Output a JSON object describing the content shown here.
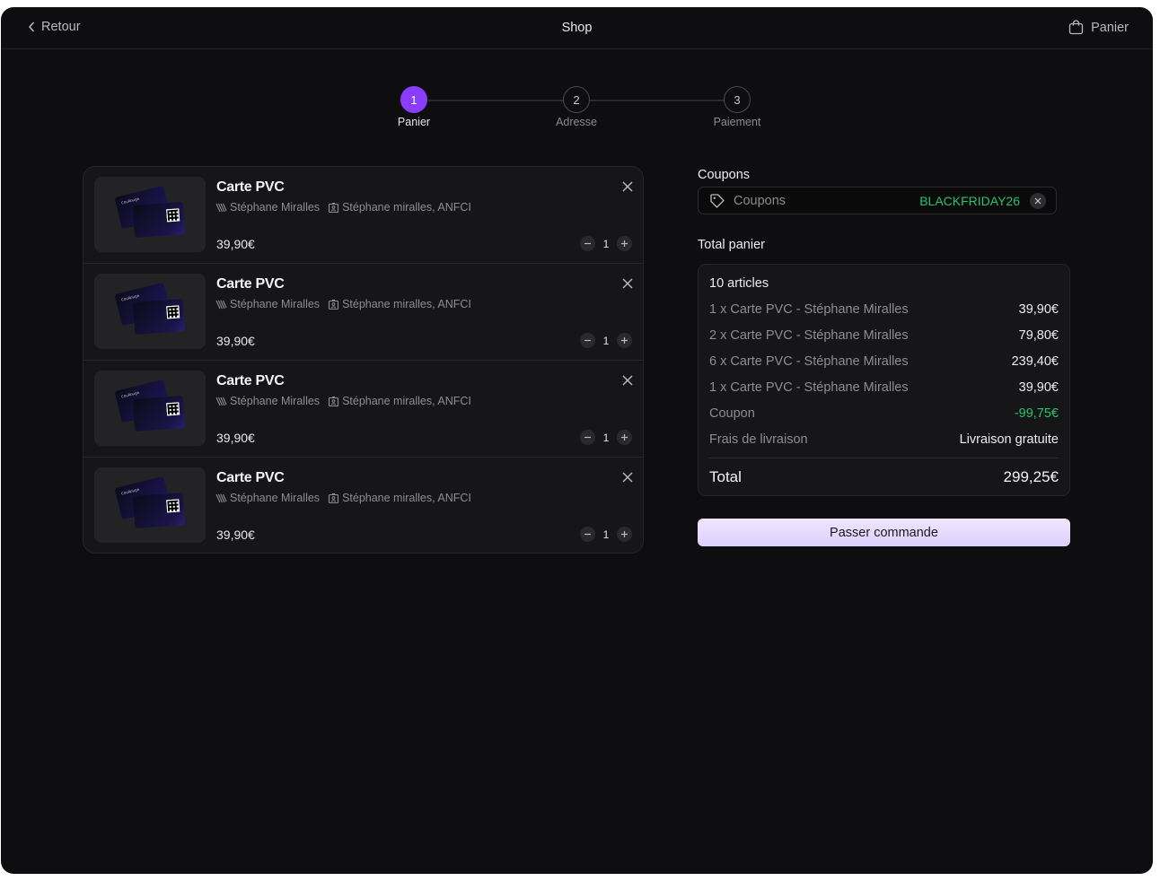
{
  "header": {
    "back_label": "Retour",
    "title": "Shop",
    "cart_label": "Panier"
  },
  "stepper": {
    "steps": [
      {
        "number": "1",
        "label": "Panier",
        "active": true
      },
      {
        "number": "2",
        "label": "Adresse",
        "active": false
      },
      {
        "number": "3",
        "label": "Paiement",
        "active": false
      }
    ]
  },
  "cart": {
    "items": [
      {
        "title": "Carte PVC",
        "author": "Stéphane Miralles",
        "org": "Stéphane miralles, ANFCI",
        "price": "39,90€",
        "quantity": "1",
        "card_logo": "CouRouge"
      },
      {
        "title": "Carte PVC",
        "author": "Stéphane Miralles",
        "org": "Stéphane miralles, ANFCI",
        "price": "39,90€",
        "quantity": "1",
        "card_logo": "CouRouge"
      },
      {
        "title": "Carte PVC",
        "author": "Stéphane Miralles",
        "org": "Stéphane miralles, ANFCI",
        "price": "39,90€",
        "quantity": "1",
        "card_logo": "CouRouge"
      },
      {
        "title": "Carte PVC",
        "author": "Stéphane Miralles",
        "org": "Stéphane miralles, ANFCI",
        "price": "39,90€",
        "quantity": "1",
        "card_logo": "CouRouge"
      }
    ]
  },
  "coupons": {
    "section_label": "Coupons",
    "placeholder": "Coupons",
    "applied_code": "BLACKFRIDAY26"
  },
  "summary": {
    "section_label": "Total panier",
    "count_label": "10 articles",
    "lines": [
      {
        "label": "1 x Carte PVC - Stéphane Miralles",
        "value": "39,90€"
      },
      {
        "label": "2 x Carte PVC - Stéphane Miralles",
        "value": "79,80€"
      },
      {
        "label": "6 x Carte PVC - Stéphane Miralles",
        "value": "239,40€"
      },
      {
        "label": "1 x Carte PVC - Stéphane Miralles",
        "value": "39,90€"
      }
    ],
    "coupon_label": "Coupon",
    "coupon_value": "-99,75€",
    "shipping_label": "Frais de livraison",
    "shipping_value": "Livraison gratuite",
    "total_label": "Total",
    "total_value": "299,25€"
  },
  "checkout_button": "Passer commande",
  "colors": {
    "background": "#0e0e10",
    "accent": "#8b3dff",
    "success": "#27c46a",
    "button": "#e4d9fd"
  }
}
